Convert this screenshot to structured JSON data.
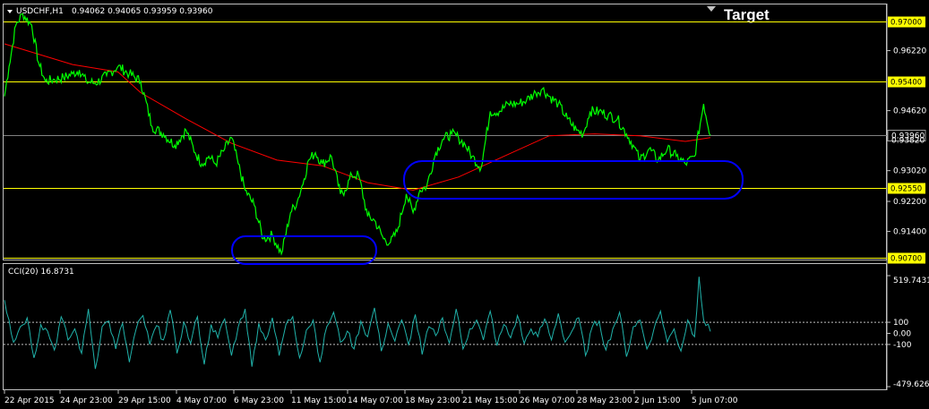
{
  "header": {
    "symbol": "USDCHF,H1",
    "ohlc": "0.94062 0.94065 0.93959 0.93960",
    "target_label": "Target"
  },
  "indicator": {
    "label": "CCI(20) 16.8731"
  },
  "colors": {
    "background": "#000000",
    "price": "#00ff00",
    "moving_average": "#ff0000",
    "cci": "#20b2aa",
    "level_lines": "#ffff00",
    "zone_ellipses": "#0000ff",
    "grid_frame": "#c0c0c0"
  },
  "chart_data": [
    {
      "type": "line",
      "title": "USDCHF,H1",
      "price_axis": {
        "ylim": [
          0.9065,
          0.9745
        ],
        "ticks": [
          "0.96220",
          "0.94620",
          "0.93020",
          "0.92200",
          "0.91400"
        ]
      },
      "levels": [
        {
          "label": "0.97000",
          "value": 0.97
        },
        {
          "label": "0.95400",
          "value": 0.954
        },
        {
          "label": "0.92550",
          "value": 0.9255
        },
        {
          "label": "0.90700",
          "value": 0.907
        }
      ],
      "current_price": {
        "label": "0.93960",
        "value": 0.9396
      },
      "hidden_tick": "0.93820",
      "x_labels": [
        "22 Apr 2015",
        "24 Apr 23:00",
        "29 Apr 15:00",
        "4 May 07:00",
        "6 May 23:00",
        "11 May 15:00",
        "14 May 07:00",
        "18 May 23:00",
        "21 May 15:00",
        "26 May 07:00",
        "28 May 23:00",
        "2 Jun 15:00",
        "5 Jun 07:00"
      ],
      "series": [
        {
          "name": "USDCHF,H1",
          "t": [
            0,
            2,
            5,
            8,
            12,
            15,
            18,
            22,
            26,
            30,
            33,
            36,
            40,
            45,
            50,
            55,
            60,
            65,
            70,
            75,
            80,
            84,
            87,
            90,
            93,
            97,
            100,
            103,
            106,
            110,
            114,
            118,
            122,
            126,
            129,
            132,
            134,
            137,
            140,
            144,
            148,
            150,
            153,
            156,
            160,
            163,
            167,
            170,
            173,
            177,
            180,
            183,
            186,
            190,
            193,
            197,
            200,
            203,
            206,
            210,
            214,
            218,
            222,
            226,
            230,
            234,
            237,
            240,
            244,
            248,
            252,
            255,
            258,
            262,
            266,
            270,
            274,
            277,
            280,
            284,
            288,
            292,
            296,
            300,
            304,
            308,
            311
          ],
          "values": [
            0.95,
            0.958,
            0.969,
            0.972,
            0.969,
            0.959,
            0.954,
            0.9545,
            0.955,
            0.956,
            0.957,
            0.954,
            0.9535,
            0.9555,
            0.958,
            0.956,
            0.954,
            0.942,
            0.94,
            0.937,
            0.941,
            0.935,
            0.932,
            0.934,
            0.932,
            0.936,
            0.939,
            0.932,
            0.925,
            0.921,
            0.912,
            0.913,
            0.908,
            0.919,
            0.922,
            0.928,
            0.933,
            0.935,
            0.932,
            0.934,
            0.924,
            0.925,
            0.929,
            0.929,
            0.918,
            0.917,
            0.912,
            0.911,
            0.914,
            0.924,
            0.919,
            0.925,
            0.926,
            0.935,
            0.9385,
            0.94,
            0.939,
            0.937,
            0.934,
            0.931,
            0.946,
            0.946,
            0.948,
            0.948,
            0.949,
            0.951,
            0.952,
            0.95,
            0.948,
            0.944,
            0.941,
            0.94,
            0.946,
            0.946,
            0.945,
            0.944,
            0.94,
            0.937,
            0.933,
            0.936,
            0.933,
            0.936,
            0.934,
            0.932,
            0.934,
            0.948,
            0.9396
          ]
        },
        {
          "name": "",
          "t": [
            0,
            30,
            50,
            60,
            80,
            100,
            120,
            140,
            160,
            180,
            200,
            220,
            240,
            260,
            280,
            300,
            311
          ],
          "values": [
            0.964,
            0.9585,
            0.9565,
            0.951,
            0.944,
            0.9375,
            0.933,
            0.9315,
            0.927,
            0.925,
            0.9285,
            0.934,
            0.9395,
            0.94,
            0.9395,
            0.938,
            0.939
          ]
        }
      ]
    },
    {
      "type": "line",
      "title": "CCI(20) 16.8731",
      "ylim": [
        -479.6265,
        519.7431
      ],
      "axis_labels": [
        "519.7431",
        "100",
        "0.00",
        "-100",
        "-479.6265"
      ],
      "levels": [
        100,
        -100
      ],
      "series": [
        {
          "name": "CCI(20) 16.8731",
          "t": [
            0,
            2,
            4,
            7,
            10,
            13,
            16,
            19,
            22,
            25,
            28,
            31,
            34,
            37,
            40,
            43,
            46,
            49,
            52,
            55,
            58,
            61,
            64,
            67,
            70,
            73,
            76,
            79,
            82,
            85,
            88,
            91,
            94,
            97,
            100,
            103,
            106,
            109,
            112,
            115,
            118,
            121,
            124,
            127,
            130,
            133,
            136,
            139,
            142,
            145,
            148,
            151,
            154,
            157,
            160,
            163,
            166,
            169,
            172,
            175,
            178,
            181,
            184,
            187,
            190,
            193,
            196,
            199,
            202,
            205,
            208,
            211,
            214,
            217,
            220,
            223,
            226,
            229,
            232,
            235,
            238,
            241,
            244,
            247,
            250,
            253,
            256,
            259,
            262,
            265,
            268,
            271,
            274,
            277,
            280,
            283,
            286,
            289,
            292,
            295,
            298,
            301,
            304,
            306,
            308,
            311
          ],
          "values": [
            300,
            120,
            -80,
            60,
            140,
            -220,
            80,
            20,
            -150,
            150,
            -60,
            40,
            -180,
            220,
            -320,
            60,
            110,
            -140,
            90,
            -260,
            40,
            160,
            -100,
            70,
            -60,
            210,
            -180,
            100,
            -90,
            150,
            -280,
            80,
            -40,
            130,
            -200,
            60,
            220,
            -300,
            90,
            -60,
            140,
            -200,
            80,
            150,
            -220,
            30,
            120,
            -260,
            60,
            190,
            -80,
            20,
            -140,
            110,
            -30,
            230,
            -160,
            90,
            -70,
            120,
            -100,
            170,
            -190,
            60,
            -20,
            140,
            -90,
            220,
            -140,
            40,
            120,
            -60,
            200,
            -110,
            80,
            -40,
            160,
            -90,
            40,
            -30,
            130,
            -60,
            180,
            -80,
            20,
            140,
            -200,
            60,
            110,
            -150,
            40,
            190,
            -210,
            60,
            120,
            -140,
            30,
            200,
            -80,
            40,
            -160,
            120,
            -30,
            510,
            120,
            16.8731
          ]
        }
      ]
    }
  ]
}
